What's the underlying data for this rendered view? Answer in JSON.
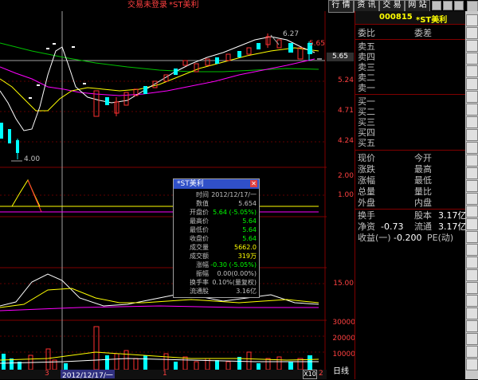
{
  "topbar": {
    "trade_status": "交易未登录",
    "stock_name": "*ST美利",
    "tabs": [
      "行 情",
      "资 讯",
      "交 易",
      "网 站"
    ]
  },
  "colors": {
    "up": "#ff3030",
    "down": "#00ffff",
    "ma_white": "#ffffff",
    "ma_yellow": "#ffff00",
    "ma_magenta": "#ff00ff",
    "ma_green": "#00c000",
    "axis_red": "#ff4040",
    "panel_border": "#800000"
  },
  "chart": {
    "price_ticks": [
      "5.65",
      "5.24",
      "4.71",
      "4.24"
    ],
    "current_price": "5.65",
    "high_label": "6.27",
    "low_label": "4.00",
    "top_value": "5.65",
    "vol_ind_ticks": [
      "2.00",
      "1.00"
    ],
    "ind2_tick": "15.00",
    "volume_ticks": [
      "30000",
      "20000",
      "10000"
    ],
    "date_label": "2012/12/17/一",
    "axis_marker_1": "3",
    "axis_marker_2": "1",
    "axis_marker_3": "2",
    "period_button": "日线",
    "zoom_label": "X10"
  },
  "popup": {
    "title": "*ST美利",
    "rows": [
      {
        "label": "时间",
        "value": "2012/12/17/一",
        "color": "#c0c0c0"
      },
      {
        "label": "数值",
        "value": "5.654",
        "color": "#c0c0c0"
      },
      {
        "label": "开盘价",
        "value": "5.64 (-5.05%)",
        "color": "#00ff00"
      },
      {
        "label": "最高价",
        "value": "5.64",
        "color": "#00ff00"
      },
      {
        "label": "最低价",
        "value": "5.64",
        "color": "#00ff00"
      },
      {
        "label": "收盘价",
        "value": "5.64",
        "color": "#00ff00"
      },
      {
        "label": "成交量",
        "value": "5662.0",
        "color": "#ffff00"
      },
      {
        "label": "成交额",
        "value": "319万",
        "color": "#ffff00"
      },
      {
        "label": "涨幅",
        "value": "-0.30 (-5.05%)",
        "color": "#00ff00"
      },
      {
        "label": "振幅",
        "value": "0.00(0.00%)",
        "color": "#c0c0c0"
      },
      {
        "label": "换手率",
        "value": "0.10%(量复权)",
        "color": "#c0c0c0"
      },
      {
        "label": "流通股",
        "value": "3.16亿",
        "color": "#c0c0c0"
      }
    ]
  },
  "panel": {
    "code": "000815",
    "name": "*ST美利",
    "weibi_label": "委比",
    "weicha_label": "委差",
    "sell": [
      "卖五",
      "卖四",
      "卖三",
      "卖二",
      "卖一"
    ],
    "buy": [
      "买一",
      "买二",
      "买三",
      "买四",
      "买五"
    ],
    "stats_left": [
      "现价",
      "涨跌",
      "涨幅",
      "总量",
      "外盘"
    ],
    "stats_right": [
      "今开",
      "最高",
      "最低",
      "量比",
      "内盘"
    ],
    "turnover_label": "换手",
    "equity_label": "股本",
    "equity_value": "3.17亿",
    "netasset_label": "净资",
    "netasset_value": "-0.73",
    "float_label": "流通",
    "float_value": "3.17亿",
    "eps_label": "收益(一)",
    "eps_value": "-0.200",
    "pe_label": "PE(动)"
  }
}
